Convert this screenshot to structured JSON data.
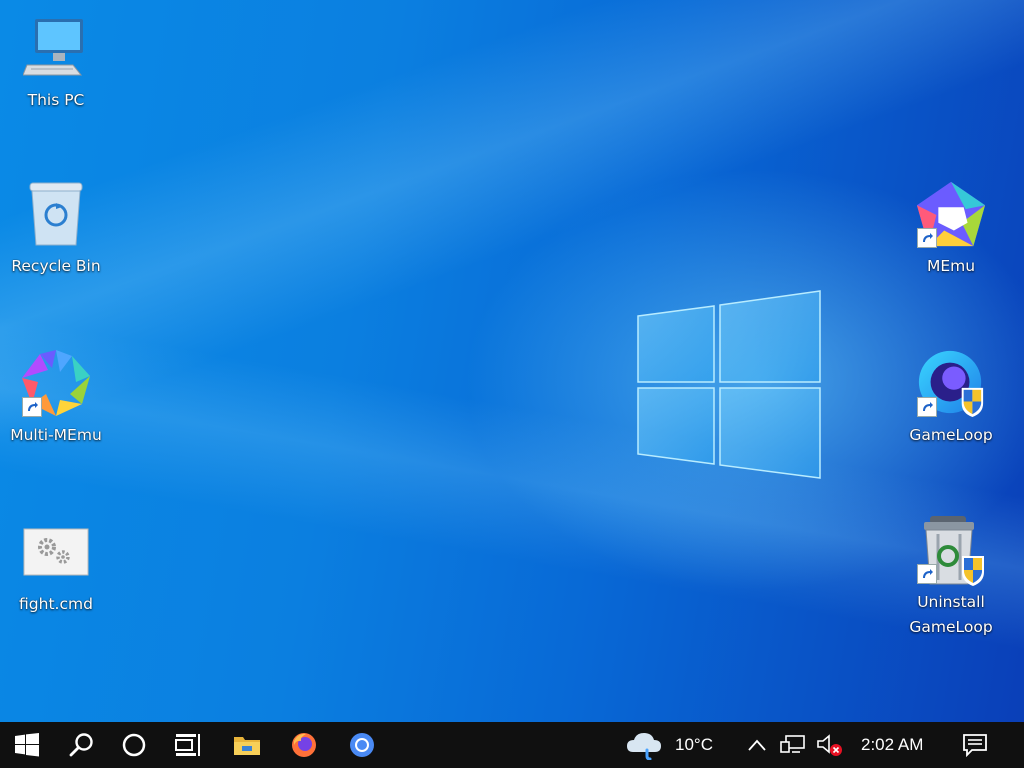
{
  "desktop": {
    "icons": [
      {
        "label": "This PC",
        "icon": "computer-icon"
      },
      {
        "label": "Recycle Bin",
        "icon": "recycle-bin-icon"
      },
      {
        "label": "Multi-MEmu",
        "icon": "multi-memu-icon"
      },
      {
        "label": "fight.cmd",
        "icon": "cmd-file-icon"
      },
      {
        "label": "MEmu",
        "icon": "memu-icon"
      },
      {
        "label": "GameLoop",
        "icon": "gameloop-icon"
      },
      {
        "label": "Uninstall\nGameLoop",
        "icon": "uninstall-gameloop-icon"
      }
    ]
  },
  "taskbar": {
    "start": "start-icon",
    "search": "search-icon",
    "cortana": "cortana-icon",
    "taskview": "task-view-icon",
    "pinned": [
      "file-explorer-icon",
      "firefox-icon",
      "chrome-icon"
    ],
    "weather": {
      "temp": "10°C",
      "icon": "weather-icon"
    },
    "tray": [
      "chevron-up-icon",
      "network-icon",
      "volume-muted-icon"
    ],
    "clock": "2:02 AM",
    "notifications": "notification-icon"
  },
  "colors": {
    "taskbar": "#101010",
    "desktop_accent": "#0b7fe0"
  }
}
